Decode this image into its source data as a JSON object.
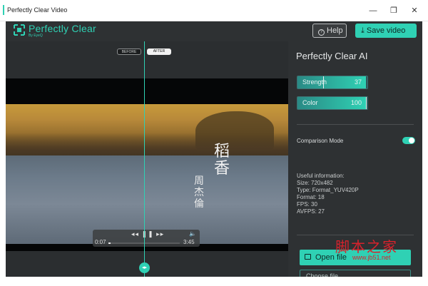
{
  "window": {
    "title": "Perfectly Clear Video",
    "minimize": "—",
    "restore": "❐",
    "close": "✕"
  },
  "header": {
    "logo": "Perfectly Clear",
    "logo_sub": "By EyeQ",
    "help_label": "Help",
    "help_icon": "?",
    "save_label": "⤓ Save video"
  },
  "video": {
    "before_label": "BEFORE",
    "after_label": "AFTER",
    "subtitle_title": "稻香",
    "subtitle_name": "周杰倫",
    "split_handle": "◂▸",
    "controls": {
      "buttons": "◂◂ ❚❚ ▸▸",
      "volume": "🔈",
      "current_time": "0:07",
      "total_time": "3:45",
      "progress": 0.03
    }
  },
  "panel": {
    "title": "Perfectly Clear AI",
    "sliders": [
      {
        "label": "Strength",
        "value": "37",
        "fill": 0.98,
        "marker": 0.37
      },
      {
        "label": "Color",
        "value": "100",
        "fill": 0.98,
        "marker": 0.98
      }
    ],
    "comparison_label": "Comparison Mode",
    "comparison_on": true,
    "info_title": "Useful information:",
    "info_lines": [
      "Size: 720x482",
      "Type: Format_YUV420P",
      "Format: 18",
      "FPS: 30",
      "AVFPS: 27"
    ],
    "open_label": "Open file",
    "choose_label": "Choose file"
  },
  "watermark": {
    "text": "脚本之家",
    "url": "www.jb51.net"
  },
  "colors": {
    "accent": "#2fd1b4",
    "panel_bg": "#2e3133"
  }
}
